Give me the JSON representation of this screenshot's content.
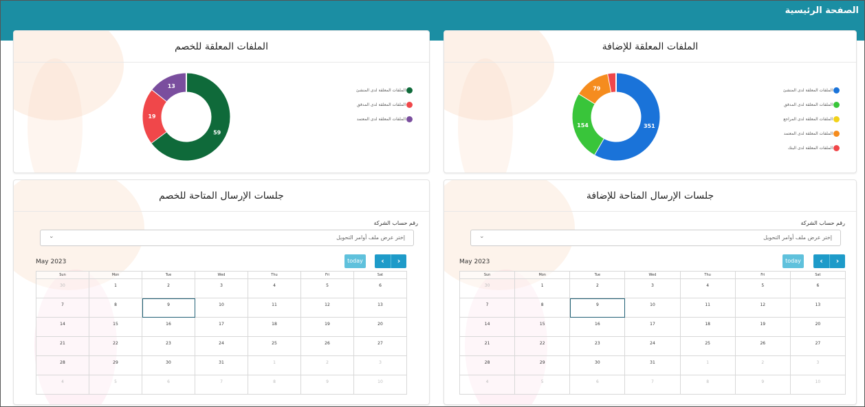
{
  "header": {
    "title": "الصفحة الرئيسية"
  },
  "colors": {
    "header_bg": "#1b8ea3"
  },
  "left_donut_card": {
    "title": "الملفات المعلقة للخصم",
    "legend": [
      {
        "label": "الملفات المعلقة لدى المنشئ",
        "color": "#0f6a3a"
      },
      {
        "label": "الملفات المعلقة لدى المدقق",
        "color": "#f0474a"
      },
      {
        "label": "الملفات المعلقة لدى المعتمد",
        "color": "#7a4e9e"
      }
    ],
    "segments": [
      {
        "value": 59,
        "color": "#0f6a3a",
        "label": "59"
      },
      {
        "value": 19,
        "color": "#f0474a",
        "label": "19"
      },
      {
        "value": 13,
        "color": "#7a4e9e",
        "label": "13"
      }
    ]
  },
  "right_donut_card": {
    "title": "الملفات المعلقة للإضافة",
    "legend": [
      {
        "label": "الملفات المعلقة لدى المنشئ",
        "color": "#1a73d9"
      },
      {
        "label": "الملفات المعلقة لدى المدقق",
        "color": "#39c53a"
      },
      {
        "label": "الملفات المعلقة لدى المراجع",
        "color": "#f2d21a"
      },
      {
        "label": "الملفات المعلقة لدى المعتمد",
        "color": "#f58c1e"
      },
      {
        "label": "الملفات المعلقة لدى البنك",
        "color": "#f0474a"
      }
    ],
    "segments": [
      {
        "value": 351,
        "color": "#1a73d9",
        "label": "351"
      },
      {
        "value": 154,
        "color": "#39c53a",
        "label": "154"
      },
      {
        "value": 79,
        "color": "#f58c1e",
        "label": "79"
      },
      {
        "value": 18,
        "color": "#f0474a",
        "label": ""
      }
    ]
  },
  "left_calendar_card": {
    "title": "جلسات الإرسال المتاحة للخصم",
    "field_label": "رقم حساب الشركة",
    "select_placeholder": "إختر عرض ملف أوامر التحويل",
    "month": "May 2023",
    "today_label": "today"
  },
  "right_calendar_card": {
    "title": "جلسات الإرسال المتاحة للإضافة",
    "field_label": "رقم حساب الشركة",
    "select_placeholder": "إختر عرض ملف أوامر التحويل",
    "month": "May 2023",
    "today_label": "today"
  },
  "calendar": {
    "weekdays": [
      "Sun",
      "Mon",
      "Tue",
      "Wed",
      "Thu",
      "Fri",
      "Sat"
    ],
    "weeks": [
      [
        "30",
        "1",
        "2",
        "3",
        "4",
        "5",
        "6"
      ],
      [
        "7",
        "8",
        "9",
        "10",
        "11",
        "12",
        "13"
      ],
      [
        "14",
        "15",
        "16",
        "17",
        "18",
        "19",
        "20"
      ],
      [
        "21",
        "22",
        "23",
        "24",
        "25",
        "26",
        "27"
      ],
      [
        "28",
        "29",
        "30",
        "31",
        "1",
        "2",
        "3"
      ],
      [
        "4",
        "5",
        "6",
        "7",
        "8",
        "9",
        "10"
      ]
    ],
    "other_month": [
      [
        true,
        false,
        false,
        false,
        false,
        false,
        false
      ],
      [
        false,
        false,
        false,
        false,
        false,
        false,
        false
      ],
      [
        false,
        false,
        false,
        false,
        false,
        false,
        false
      ],
      [
        false,
        false,
        false,
        false,
        false,
        false,
        false
      ],
      [
        false,
        false,
        false,
        false,
        true,
        true,
        true
      ],
      [
        true,
        true,
        true,
        true,
        true,
        true,
        true
      ]
    ],
    "today": "9"
  },
  "icons": {
    "prev": "chevron-left-icon",
    "next": "chevron-right-icon",
    "dropdown": "chevron-down-icon"
  }
}
